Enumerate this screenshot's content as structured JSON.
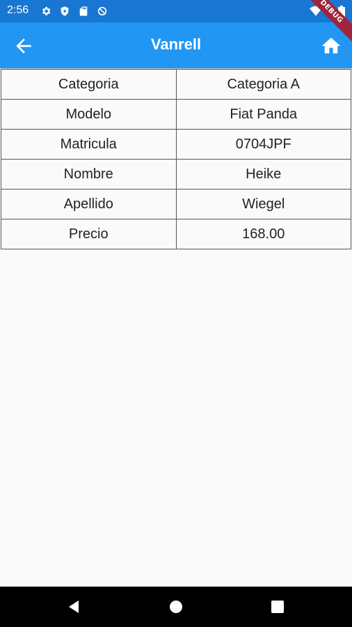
{
  "status_bar": {
    "time": "2:56",
    "icons": [
      "settings-icon",
      "shield-icon",
      "sd-card-icon",
      "data-saver-icon",
      "wifi-icon",
      "battery-icon"
    ]
  },
  "debug_banner": {
    "label": "DEBUG"
  },
  "app_bar": {
    "title": "Vanrell",
    "back_icon": "arrow-back-icon",
    "home_icon": "home-icon",
    "background_color": "#2196f3"
  },
  "details": [
    {
      "label": "Categoria",
      "value": "Categoria A"
    },
    {
      "label": "Modelo",
      "value": "Fiat Panda"
    },
    {
      "label": "Matricula",
      "value": "0704JPF"
    },
    {
      "label": "Nombre",
      "value": "Heike"
    },
    {
      "label": "Apellido",
      "value": "Wiegel"
    },
    {
      "label": "Precio",
      "value": "168.00"
    }
  ],
  "nav_bar": {
    "icons": [
      "nav-back-icon",
      "nav-home-icon",
      "nav-recents-icon"
    ]
  }
}
